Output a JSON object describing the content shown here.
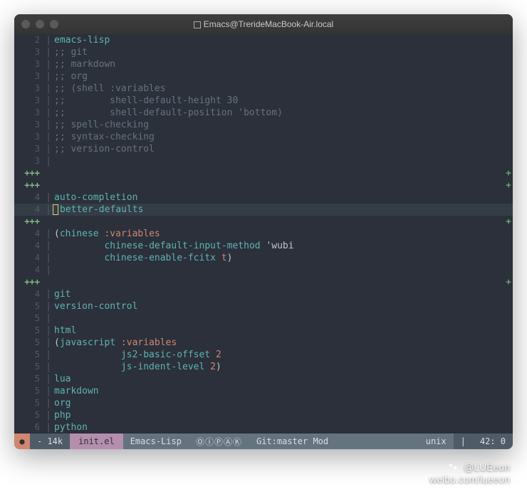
{
  "window": {
    "title": "Emacs@TrerideMacBook-Air.local"
  },
  "lines": [
    {
      "gutter": "2",
      "sep": "|",
      "segs": [
        [
          "cyan",
          "emacs-lisp"
        ]
      ]
    },
    {
      "gutter": "3",
      "sep": "|",
      "segs": [
        [
          "comment",
          ";; git"
        ]
      ]
    },
    {
      "gutter": "3",
      "sep": "|",
      "segs": [
        [
          "comment",
          ";; markdown"
        ]
      ]
    },
    {
      "gutter": "3",
      "sep": "|",
      "segs": [
        [
          "comment",
          ";; org"
        ]
      ]
    },
    {
      "gutter": "3",
      "sep": "|",
      "segs": [
        [
          "comment",
          ";; (shell :variables"
        ]
      ]
    },
    {
      "gutter": "3",
      "sep": "|",
      "segs": [
        [
          "comment",
          ";;        shell-default-height 30"
        ]
      ]
    },
    {
      "gutter": "3",
      "sep": "|",
      "segs": [
        [
          "comment",
          ";;        shell-default-position 'bottom)"
        ]
      ]
    },
    {
      "gutter": "3",
      "sep": "|",
      "segs": [
        [
          "comment",
          ";; spell-checking"
        ]
      ]
    },
    {
      "gutter": "3",
      "sep": "|",
      "segs": [
        [
          "comment",
          ";; syntax-checking"
        ]
      ]
    },
    {
      "gutter": "3",
      "sep": "|",
      "segs": [
        [
          "comment",
          ";; version-control"
        ]
      ]
    },
    {
      "gutter": "3",
      "sep": "|",
      "segs": []
    },
    {
      "gutter": "+++",
      "sep": "",
      "segs": [],
      "plusrow": true
    },
    {
      "gutter": "+++",
      "sep": "",
      "segs": [],
      "plusrow": true
    },
    {
      "gutter": "4",
      "sep": "|",
      "segs": [
        [
          "cyan",
          "auto-completion"
        ]
      ]
    },
    {
      "gutter": "4",
      "sep": "|",
      "segs": [
        [
          "cyan",
          "better-defaults"
        ]
      ],
      "highlight": true,
      "cursor": true
    },
    {
      "gutter": "+++",
      "sep": "",
      "segs": [],
      "plusrow": true
    },
    {
      "gutter": "4",
      "sep": "|",
      "segs": [
        [
          "paren",
          "("
        ],
        [
          "cyan",
          "chinese "
        ],
        [
          "kw",
          ":variables"
        ]
      ]
    },
    {
      "gutter": "4",
      "sep": "|",
      "segs": [
        [
          "paren",
          "         "
        ],
        [
          "cyan",
          "chinese-default-input-method "
        ],
        [
          "paren",
          "'wubi"
        ]
      ]
    },
    {
      "gutter": "4",
      "sep": "|",
      "segs": [
        [
          "paren",
          "         "
        ],
        [
          "cyan",
          "chinese-enable-fcitx "
        ],
        [
          "kw",
          "t"
        ],
        [
          "paren",
          ")"
        ]
      ]
    },
    {
      "gutter": "4",
      "sep": "|",
      "segs": []
    },
    {
      "gutter": "+++",
      "sep": "",
      "segs": [],
      "plusrow": true
    },
    {
      "gutter": "4",
      "sep": "|",
      "segs": [
        [
          "cyan",
          "git"
        ]
      ]
    },
    {
      "gutter": "5",
      "sep": "|",
      "segs": [
        [
          "cyan",
          "version-control"
        ]
      ]
    },
    {
      "gutter": "5",
      "sep": "|",
      "segs": []
    },
    {
      "gutter": "5",
      "sep": "|",
      "segs": [
        [
          "cyan",
          "html"
        ]
      ]
    },
    {
      "gutter": "5",
      "sep": "|",
      "segs": [
        [
          "paren",
          "("
        ],
        [
          "cyan",
          "javascript "
        ],
        [
          "kw",
          ":variables"
        ]
      ]
    },
    {
      "gutter": "5",
      "sep": "|",
      "segs": [
        [
          "paren",
          "            "
        ],
        [
          "cyan",
          "js2-basic-offset "
        ],
        [
          "num",
          "2"
        ]
      ]
    },
    {
      "gutter": "5",
      "sep": "|",
      "segs": [
        [
          "paren",
          "            "
        ],
        [
          "cyan",
          "js-indent-level "
        ],
        [
          "num",
          "2"
        ],
        [
          "paren",
          ")"
        ]
      ]
    },
    {
      "gutter": "5",
      "sep": "|",
      "segs": [
        [
          "cyan",
          "lua"
        ]
      ]
    },
    {
      "gutter": "5",
      "sep": "|",
      "segs": [
        [
          "cyan",
          "markdown"
        ]
      ]
    },
    {
      "gutter": "5",
      "sep": "|",
      "segs": [
        [
          "cyan",
          "org"
        ]
      ]
    },
    {
      "gutter": "5",
      "sep": "|",
      "segs": [
        [
          "cyan",
          "php"
        ]
      ]
    },
    {
      "gutter": "6",
      "sep": "|",
      "segs": [
        [
          "cyan",
          "python"
        ]
      ]
    }
  ],
  "modeline": {
    "warn_icon": "●",
    "size": "- 14k",
    "filename": "init.el",
    "major_mode": "Emacs-Lisp",
    "circles": "ⓄⒾⓅⒶⓀ",
    "vcs": "Git:master Mod",
    "encoding": "unix",
    "position": "42: 0"
  },
  "watermark": {
    "handle": "@LUEeon",
    "site": "weibo.com/lueeon"
  }
}
